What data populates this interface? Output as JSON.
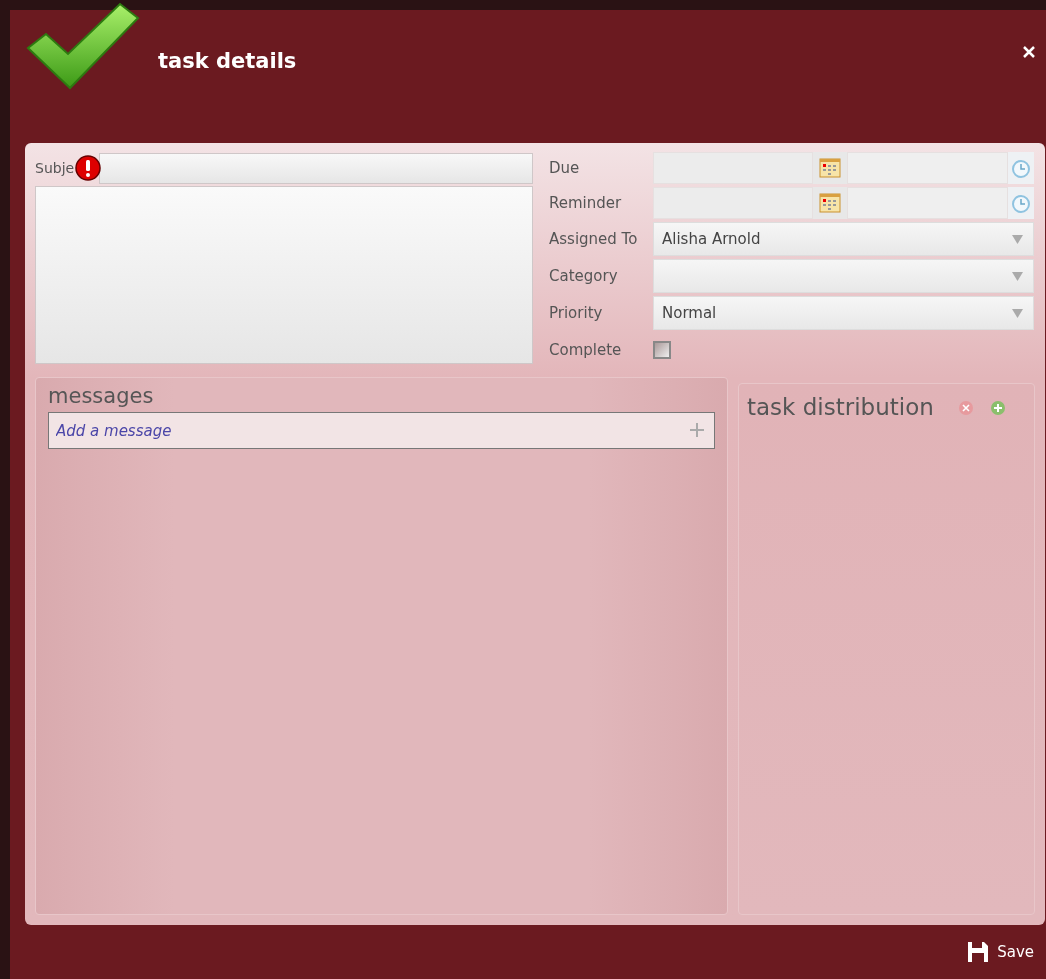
{
  "dialog": {
    "title": "task details"
  },
  "subject": {
    "label": "Subje",
    "error": true
  },
  "fields": [
    {
      "kind": "datetime",
      "label": "Due"
    },
    {
      "kind": "datetime",
      "label": "Reminder"
    },
    {
      "kind": "dropdown",
      "label": "Assigned To",
      "value": "Alisha Arnold"
    },
    {
      "kind": "dropdown",
      "label": "Category"
    },
    {
      "kind": "dropdown",
      "label": "Priority",
      "value": "Normal"
    },
    {
      "kind": "checkbox",
      "label": "Complete",
      "checked": false
    }
  ],
  "messages": {
    "title": "messages",
    "placeholder": "Add a message"
  },
  "distribution": {
    "title": "task distribution"
  },
  "save": {
    "label": "Save"
  }
}
